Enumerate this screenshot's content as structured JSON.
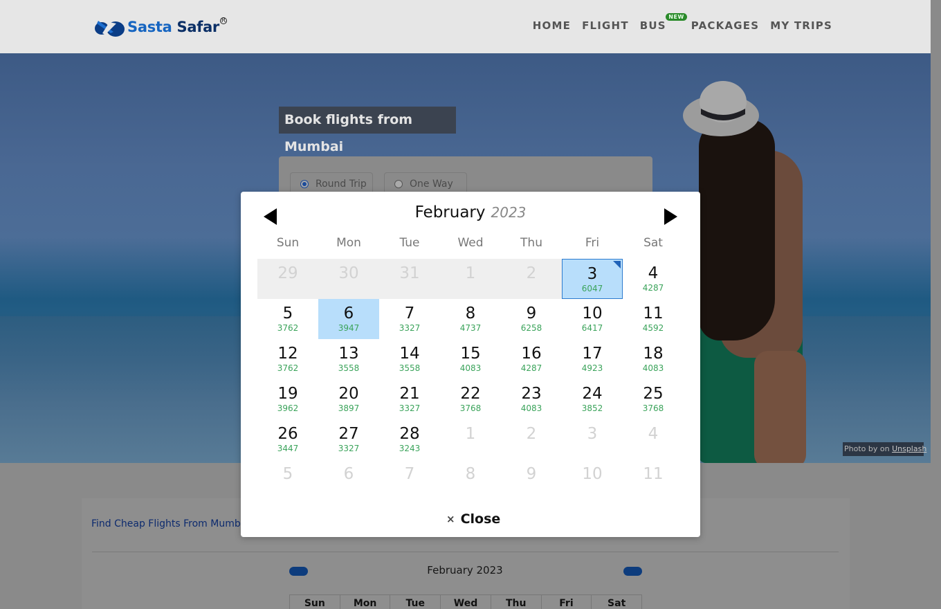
{
  "brand": {
    "name_part1": "Sasta",
    "name_part2": "Safar",
    "reg_mark": "R"
  },
  "nav": {
    "home": "HOME",
    "flight": "FLIGHT",
    "bus": "BUS",
    "bus_badge": "NEW",
    "packages": "PACKAGES",
    "my_trips": "MY TRIPS"
  },
  "hero": {
    "title": "Book flights from Mumbai",
    "round_trip_label": "Round Trip",
    "one_way_label": "One Way",
    "selected_trip_type": "Round Trip",
    "credit_prefix": "Photo by  on ",
    "credit_link": "Unsplash"
  },
  "calendar_modal": {
    "month": "February",
    "year": "2023",
    "weekdays": [
      "Sun",
      "Mon",
      "Tue",
      "Wed",
      "Thu",
      "Fri",
      "Sat"
    ],
    "weeks": [
      [
        {
          "day": "29",
          "price": "",
          "state": "prev"
        },
        {
          "day": "30",
          "price": "",
          "state": "prev"
        },
        {
          "day": "31",
          "price": "",
          "state": "prev"
        },
        {
          "day": "1",
          "price": "",
          "state": "prev"
        },
        {
          "day": "2",
          "price": "",
          "state": "prev"
        },
        {
          "day": "3",
          "price": "6047",
          "state": "start"
        },
        {
          "day": "4",
          "price": "4287",
          "state": ""
        }
      ],
      [
        {
          "day": "5",
          "price": "3762",
          "state": ""
        },
        {
          "day": "6",
          "price": "3947",
          "state": "sel"
        },
        {
          "day": "7",
          "price": "3327",
          "state": ""
        },
        {
          "day": "8",
          "price": "4737",
          "state": ""
        },
        {
          "day": "9",
          "price": "6258",
          "state": ""
        },
        {
          "day": "10",
          "price": "6417",
          "state": ""
        },
        {
          "day": "11",
          "price": "4592",
          "state": ""
        }
      ],
      [
        {
          "day": "12",
          "price": "3762",
          "state": ""
        },
        {
          "day": "13",
          "price": "3558",
          "state": ""
        },
        {
          "day": "14",
          "price": "3558",
          "state": ""
        },
        {
          "day": "15",
          "price": "4083",
          "state": ""
        },
        {
          "day": "16",
          "price": "4287",
          "state": ""
        },
        {
          "day": "17",
          "price": "4923",
          "state": ""
        },
        {
          "day": "18",
          "price": "4083",
          "state": ""
        }
      ],
      [
        {
          "day": "19",
          "price": "3962",
          "state": ""
        },
        {
          "day": "20",
          "price": "3897",
          "state": ""
        },
        {
          "day": "21",
          "price": "3327",
          "state": ""
        },
        {
          "day": "22",
          "price": "3768",
          "state": ""
        },
        {
          "day": "23",
          "price": "4083",
          "state": ""
        },
        {
          "day": "24",
          "price": "3852",
          "state": ""
        },
        {
          "day": "25",
          "price": "3768",
          "state": ""
        }
      ],
      [
        {
          "day": "26",
          "price": "3447",
          "state": ""
        },
        {
          "day": "27",
          "price": "3327",
          "state": ""
        },
        {
          "day": "28",
          "price": "3243",
          "state": ""
        },
        {
          "day": "1",
          "price": "",
          "state": "next"
        },
        {
          "day": "2",
          "price": "",
          "state": "next"
        },
        {
          "day": "3",
          "price": "",
          "state": "next"
        },
        {
          "day": "4",
          "price": "",
          "state": "next"
        }
      ],
      [
        {
          "day": "5",
          "price": "",
          "state": "next"
        },
        {
          "day": "6",
          "price": "",
          "state": "next"
        },
        {
          "day": "7",
          "price": "",
          "state": "next"
        },
        {
          "day": "8",
          "price": "",
          "state": "next"
        },
        {
          "day": "9",
          "price": "",
          "state": "next"
        },
        {
          "day": "10",
          "price": "",
          "state": "next"
        },
        {
          "day": "11",
          "price": "",
          "state": "next"
        }
      ]
    ],
    "close_label": "Close",
    "close_icon": "×"
  },
  "lower": {
    "find_text": "Find Cheap Flights From Mumbai",
    "mini_calendar_month": "February 2023",
    "mini_weekdays": [
      "Sun",
      "Mon",
      "Tue",
      "Wed",
      "Thu",
      "Fri",
      "Sat"
    ]
  },
  "colors": {
    "brand_blue": "#1665c1",
    "price_green": "#3aa35a",
    "selected_bg": "#b8defb",
    "start_border": "#2b7bcf"
  }
}
